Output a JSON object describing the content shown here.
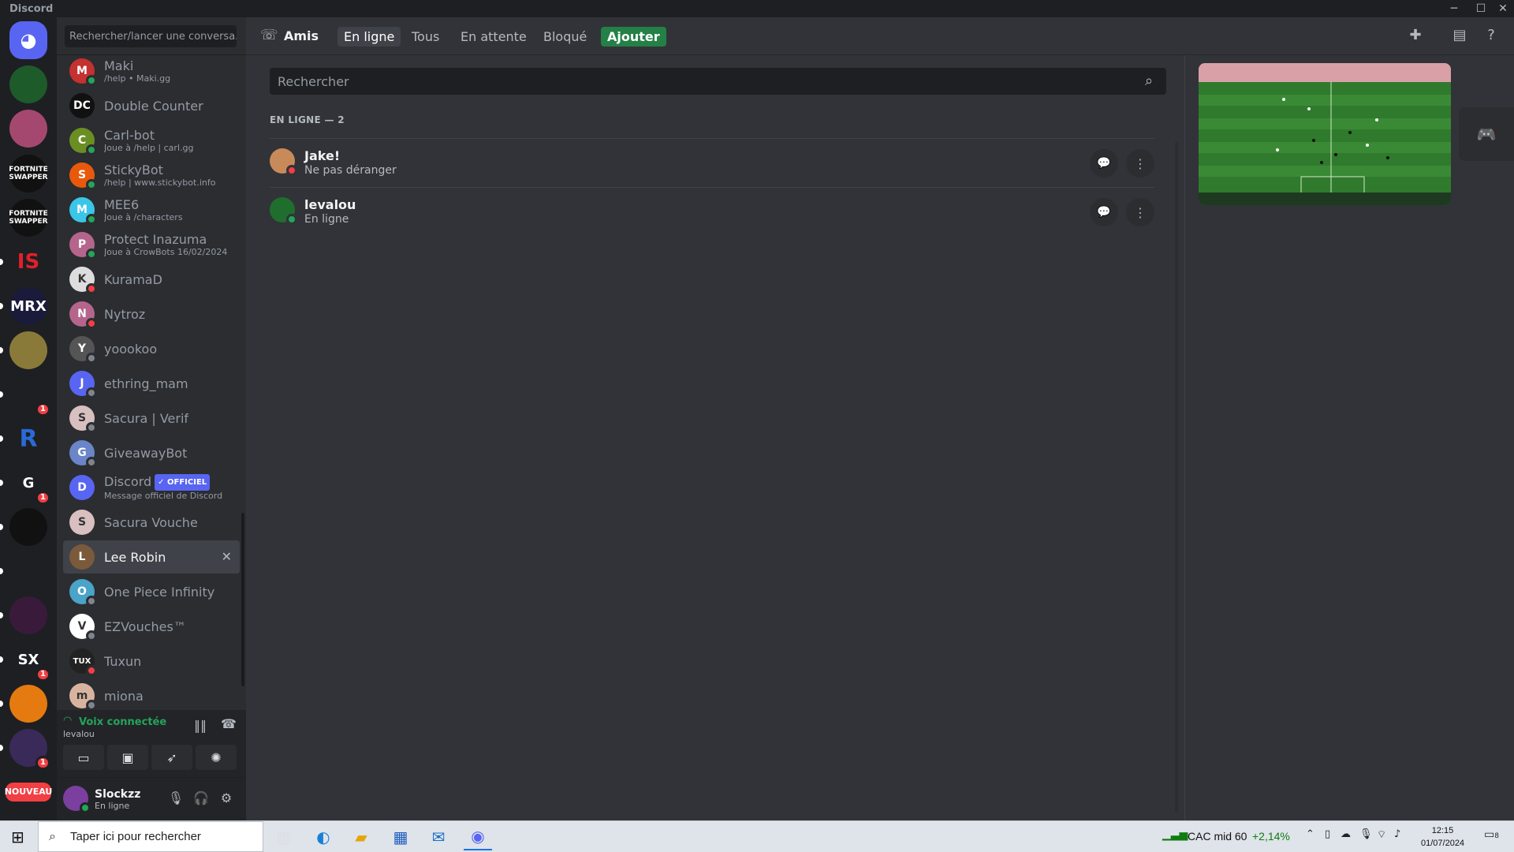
{
  "window": {
    "title": "Discord"
  },
  "dm_search": {
    "placeholder": "Rechercher/lancer une conversa..."
  },
  "servers": [
    {
      "name": "discord-home",
      "label": "",
      "badge": ""
    },
    {
      "name": "levalou",
      "label": "",
      "badge": ""
    },
    {
      "name": "server-3",
      "label": "",
      "badge": ""
    },
    {
      "name": "fortnite-swapper",
      "label": "FORTNITE SWAPPER",
      "badge": ""
    },
    {
      "name": "fortnite-swapper-2",
      "label": "FORTNITE SWAPPER",
      "badge": ""
    },
    {
      "name": "is",
      "label": "IS",
      "badge": ""
    },
    {
      "name": "mrx",
      "label": "MRX",
      "badge": ""
    },
    {
      "name": "server-8",
      "label": "",
      "badge": ""
    },
    {
      "name": "server-9",
      "label": "",
      "badge": "1"
    },
    {
      "name": "r",
      "label": "R",
      "badge": ""
    },
    {
      "name": "g",
      "label": "G",
      "badge": "1"
    },
    {
      "name": "globe",
      "label": "",
      "badge": ""
    },
    {
      "name": "shield",
      "label": "",
      "badge": ""
    },
    {
      "name": "server-14",
      "label": "",
      "badge": ""
    },
    {
      "name": "sx",
      "label": "SX",
      "badge": "1"
    },
    {
      "name": "orange",
      "label": "",
      "badge": ""
    },
    {
      "name": "owl",
      "label": "",
      "badge": "1"
    },
    {
      "name": "nouveau",
      "label": "NOUVEAU",
      "badge": ""
    }
  ],
  "dms": [
    {
      "name": "Maki",
      "sub": "/help • Maki.gg",
      "status": "on",
      "color": "#c53030",
      "initial": "M"
    },
    {
      "name": "Double Counter",
      "sub": "",
      "status": "",
      "color": "#111",
      "initial": "DC"
    },
    {
      "name": "Carl-bot",
      "sub": "Joue à /help | carl.gg",
      "status": "on",
      "color": "#6b8e23",
      "initial": "C"
    },
    {
      "name": "StickyBot",
      "sub": "/help | www.stickybot.info",
      "status": "on",
      "color": "#e8590c",
      "initial": "S"
    },
    {
      "name": "MEE6",
      "sub": "Joue à /characters",
      "status": "on",
      "color": "#3bc6e8",
      "initial": "M"
    },
    {
      "name": "Protect Inazuma",
      "sub": "Joue à CrowBots 16/02/2024",
      "status": "on",
      "color": "#b5658c",
      "initial": "P"
    },
    {
      "name": "KuramaD",
      "sub": "",
      "status": "dnd",
      "color": "#ddd",
      "initial": "K"
    },
    {
      "name": "Nytroz",
      "sub": "",
      "status": "dnd",
      "color": "#b5658c",
      "initial": "N"
    },
    {
      "name": "yoookoo",
      "sub": "",
      "status": "off",
      "color": "#555",
      "initial": "Y"
    },
    {
      "name": "ethring_mam",
      "sub": "",
      "status": "off",
      "color": "#5865f2",
      "initial": "J"
    },
    {
      "name": "Sacura | Verif",
      "sub": "",
      "status": "off",
      "color": "#d9c0c0",
      "initial": "S"
    },
    {
      "name": "GiveawayBot",
      "sub": "",
      "status": "off",
      "color": "#6a86c8",
      "initial": "G"
    },
    {
      "name": "Discord",
      "sub": "Message officiel de Discord",
      "status": "",
      "color": "#5865f2",
      "initial": "D",
      "badge": "✓ OFFICIEL"
    },
    {
      "name": "Sacura Vouche",
      "sub": "",
      "status": "",
      "color": "#d9c0c0",
      "initial": "S"
    },
    {
      "name": "Lee Robin",
      "sub": "",
      "status": "",
      "color": "#7a5a3a",
      "initial": "L",
      "selected": true
    },
    {
      "name": "One Piece Infinity",
      "sub": "",
      "status": "off",
      "color": "#4aa3c8",
      "initial": "O"
    },
    {
      "name": "EZVouches™",
      "sub": "",
      "status": "off",
      "color": "#fff",
      "initial": "V"
    },
    {
      "name": "Tuxun",
      "sub": "",
      "status": "dnd",
      "color": "#222",
      "initial": "TUX"
    },
    {
      "name": "miona",
      "sub": "",
      "status": "off",
      "color": "#d8b4a0",
      "initial": "m"
    }
  ],
  "voice": {
    "title": "Voix connectée",
    "channel": "levalou"
  },
  "user": {
    "name": "Slockzz",
    "status": "En ligne"
  },
  "header": {
    "title": "Amis",
    "tabs": [
      "En ligne",
      "Tous",
      "En attente",
      "Bloqué"
    ],
    "add": "Ajouter"
  },
  "friends_search": {
    "placeholder": "Rechercher"
  },
  "online_header": "EN LIGNE — 2",
  "friends": [
    {
      "name": "Jake!",
      "status": "Ne pas déranger",
      "dot": "dnd",
      "color": "#c98a5a"
    },
    {
      "name": "levalou",
      "status": "En ligne",
      "dot": "on",
      "color": "#1f6e2e"
    }
  ],
  "taskbar": {
    "search_placeholder": "Taper ici pour rechercher",
    "stock_name": "CAC mid 60",
    "stock_change": "+2,14%",
    "time": "12:15",
    "date": "01/07/2024",
    "notif_count": "8"
  }
}
